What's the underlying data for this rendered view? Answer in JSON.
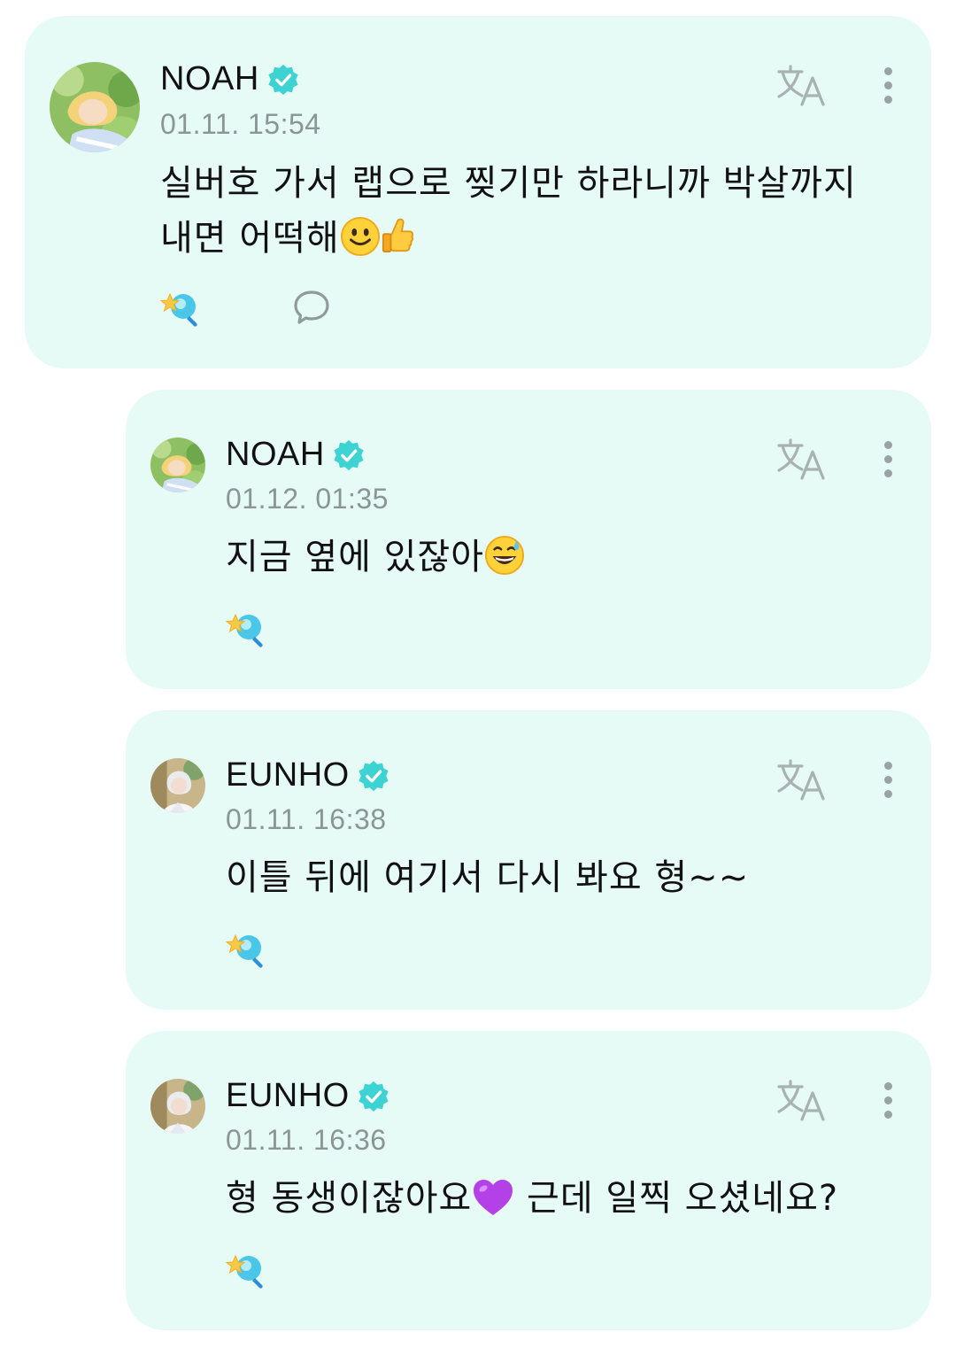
{
  "posts": [
    {
      "author": "NOAH",
      "timestamp": "01.11. 15:54",
      "message_line1": "실버호 가서 랩으로 찢기만 하라니까 박살까지",
      "message_line2": "내면 어떡해",
      "emojis": [
        "slightly-smiling-face",
        "thumbs-up"
      ],
      "avatar": "noah-avatar",
      "has_comment_button": true
    },
    {
      "author": "NOAH",
      "timestamp": "01.12. 01:35",
      "message": "지금 옆에 있잖아",
      "emojis": [
        "grinning-face-with-sweat"
      ],
      "avatar": "noah-avatar"
    },
    {
      "author": "EUNHO",
      "timestamp": "01.11. 16:38",
      "message": "이틀 뒤에 여기서 다시 봐요 형~~",
      "avatar": "eunho-avatar"
    },
    {
      "author": "EUNHO",
      "timestamp": "01.11. 16:36",
      "message_part1": "형 동생이잖아요",
      "message_part2": " 근데 일찍 오셨네요?",
      "emojis": [
        "purple-heart"
      ],
      "avatar": "eunho-avatar"
    }
  ],
  "icons": {
    "verified": "verified-badge-icon",
    "translate": "translate-icon",
    "more": "more-vertical-icon",
    "reaction": "reaction-light-icon",
    "comment": "comment-bubble-icon"
  },
  "colors": {
    "card_background": "#e7fbf6",
    "verified_badge": "#3ed3d3",
    "icon_gray": "#9aa3a3",
    "timestamp_gray": "#8a9595"
  }
}
